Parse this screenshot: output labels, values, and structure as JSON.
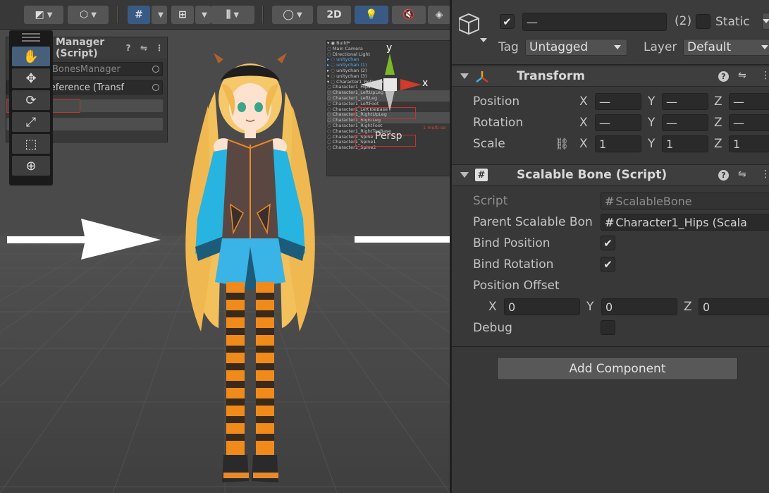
{
  "scene": {
    "toolbar": {
      "mode_2d_label": "2D"
    },
    "overlay_inspector": {
      "title": "Manager (Script)",
      "script_field": "BonesManager",
      "reference_field": "acter1_Reference (Transf",
      "red_field": "p"
    },
    "hierarchy_overlay": {
      "rows": [
        {
          "text": "▾ ◉ Build*",
          "blue": false,
          "sel": false
        },
        {
          "text": "      ◌ Main Camera",
          "blue": false,
          "sel": false
        },
        {
          "text": "      ◌ Directional Light",
          "blue": false,
          "sel": false
        },
        {
          "text": "  ▸ ◌ unitychan",
          "blue": true,
          "sel": false
        },
        {
          "text": "  ▸ ◌ unitychan (1)",
          "blue": true,
          "sel": false
        },
        {
          "text": "  ▸ ◌ unitychan (2)",
          "blue": false,
          "sel": false
        },
        {
          "text": "  ▾ ◌ unitychan (3)",
          "blue": false,
          "sel": false
        },
        {
          "text": "     ▾ ◌ Character1_Reference",
          "blue": false,
          "sel": false
        },
        {
          "text": "          ◌ Character1_Hips",
          "blue": false,
          "sel": false
        },
        {
          "text": "          ◌ Character1_LeftUpLeg",
          "blue": false,
          "sel": true
        },
        {
          "text": "          ◌ Character1_LeftLeg",
          "blue": false,
          "sel": true
        },
        {
          "text": "          ◌ Character1_LeftFoot",
          "blue": false,
          "sel": false
        },
        {
          "text": "          ◌ Character1_LeftToeBase",
          "blue": false,
          "sel": false
        },
        {
          "text": "          ◌ Character1_RightUpLeg",
          "blue": false,
          "sel": true
        },
        {
          "text": "          ◌ Character1_RightLeg",
          "blue": false,
          "sel": true
        },
        {
          "text": "          ◌ Character1_RightFoot",
          "blue": false,
          "sel": false
        },
        {
          "text": "          ◌ Character1_RightToeBase",
          "blue": false,
          "sel": false
        },
        {
          "text": "          ◌ Character1_Spine",
          "blue": false,
          "sel": false
        },
        {
          "text": "          ◌ Character1_Spine1",
          "blue": false,
          "sel": false
        },
        {
          "text": "          ◌ Character1_Spine2",
          "blue": false,
          "sel": false
        }
      ],
      "note": "1 multi-se"
    },
    "gizmo": {
      "y_label": "y",
      "x_label": "x",
      "persp_label": "Persp"
    }
  },
  "inspector": {
    "gameobject": {
      "active": true,
      "name_value": "—",
      "count": "(2)",
      "static_label": "Static",
      "tag_label": "Tag",
      "tag_value": "Untagged",
      "layer_label": "Layer",
      "layer_value": "Default"
    },
    "transform": {
      "title": "Transform",
      "position_label": "Position",
      "rotation_label": "Rotation",
      "scale_label": "Scale",
      "axis_x": "X",
      "axis_y": "Y",
      "axis_z": "Z",
      "position": {
        "x": "—",
        "y": "—",
        "z": "—"
      },
      "rotation": {
        "x": "—",
        "y": "—",
        "z": "—"
      },
      "scale": {
        "x": "1",
        "y": "1",
        "z": "1"
      }
    },
    "scalable_bone": {
      "title": "Scalable Bone (Script)",
      "script_label": "Script",
      "script_value": "ScalableBone",
      "parent_label": "Parent Scalable Bon",
      "parent_value": "Character1_Hips (Scala",
      "bind_position_label": "Bind Position",
      "bind_position": true,
      "bind_rotation_label": "Bind Rotation",
      "bind_rotation": true,
      "offset_label": "Position Offset",
      "offset": {
        "x": "0",
        "y": "0",
        "z": "0"
      },
      "debug_label": "Debug",
      "debug": false
    },
    "add_component_label": "Add Component"
  },
  "colors": {
    "panel_bg": "#383838",
    "field_bg": "#2a2a2a",
    "selection_blue": "#3a5a86",
    "gizmo_x": "#d23a2a",
    "gizmo_y": "#7ab82a"
  }
}
